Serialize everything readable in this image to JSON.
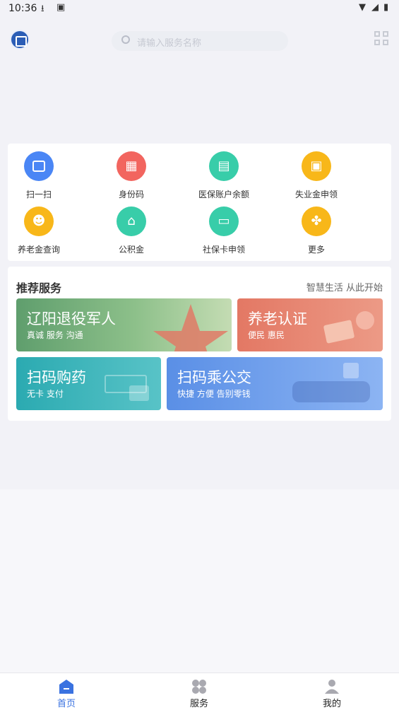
{
  "status_bar": {
    "time": "10:36"
  },
  "header": {
    "search_placeholder": "请输入服务名称"
  },
  "colors": {
    "accent": "#3a72e0",
    "page_bg": "#f2f2f7"
  },
  "services": [
    {
      "label": "扫一扫",
      "icon": "scan-icon",
      "color": "#4a86f5"
    },
    {
      "label": "身份码",
      "icon": "qr-code-icon",
      "color": "#f2655f"
    },
    {
      "label": "医保账户余额",
      "icon": "medical-card-icon",
      "color": "#38cda9"
    },
    {
      "label": "失业金申领",
      "icon": "wallet-icon",
      "color": "#f8b719"
    },
    {
      "label": "养老金查询",
      "icon": "elder-person-icon",
      "color": "#f8b719"
    },
    {
      "label": "公积金",
      "icon": "house-icon",
      "color": "#38cda9"
    },
    {
      "label": "社保卡申领",
      "icon": "social-card-icon",
      "color": "#38cda9"
    },
    {
      "label": "更多",
      "icon": "more-grid-icon",
      "color": "#f8b719"
    }
  ],
  "recommend": {
    "title": "推荐服务",
    "subtitle": "智慧生活 从此开始",
    "banners": [
      {
        "title": "辽阳退役军人",
        "sub": "真诚 服务 沟通"
      },
      {
        "title": "养老认证",
        "sub": "便民 惠民"
      },
      {
        "title": "扫码购药",
        "sub": "无卡 支付"
      },
      {
        "title": "扫码乘公交",
        "sub": "快捷 方便 告别零钱"
      }
    ]
  },
  "tabbar": {
    "tabs": [
      {
        "label": "首页",
        "icon": "home-icon",
        "active": true
      },
      {
        "label": "服务",
        "icon": "services-icon",
        "active": false
      },
      {
        "label": "我的",
        "icon": "profile-icon",
        "active": false
      }
    ]
  }
}
